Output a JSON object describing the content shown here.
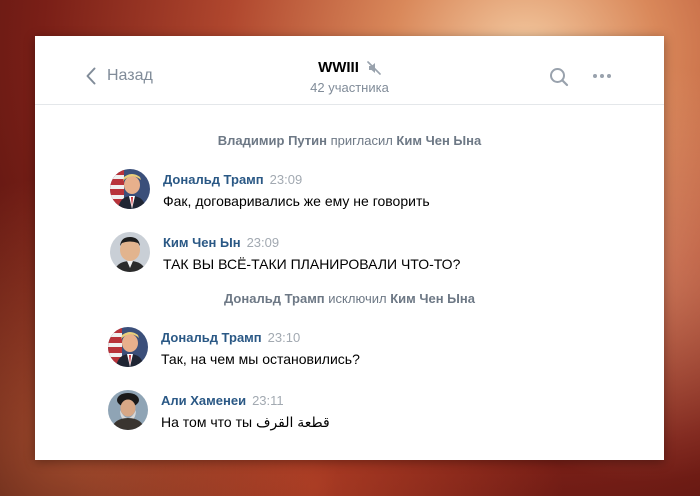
{
  "header": {
    "back_label": "Назад",
    "title": "WWIII",
    "subtitle": "42 участника"
  },
  "icons": {
    "back": "chevron-left-icon",
    "muted": "muted-speaker-icon",
    "search": "search-icon",
    "more": "more-dots-icon"
  },
  "colors": {
    "accent_name": "#2a5885",
    "secondary_text": "#818c99"
  },
  "events": [
    {
      "actor": "Владимир Путин",
      "action": "пригласил",
      "target": "Ким Чен Ына"
    },
    {
      "actor": "Дональд Трамп",
      "action": "исключил",
      "target": "Ким Чен Ына"
    }
  ],
  "messages": [
    {
      "author": "Дональд Трамп",
      "time": "23:09",
      "text": "Фак, договаривались же ему не говорить"
    },
    {
      "author": "Ким Чен Ын",
      "time": "23:09",
      "text": "ТАК ВЫ ВСЁ-ТАКИ ПЛАНИРОВАЛИ ЧТО-ТО?"
    },
    {
      "author": "Дональд Трамп",
      "time": "23:10",
      "text": "Так, на чем мы остановились?"
    },
    {
      "author": "Али Хаменеи",
      "time": "23:11",
      "text": "На том что ты قطعة القرف"
    }
  ]
}
